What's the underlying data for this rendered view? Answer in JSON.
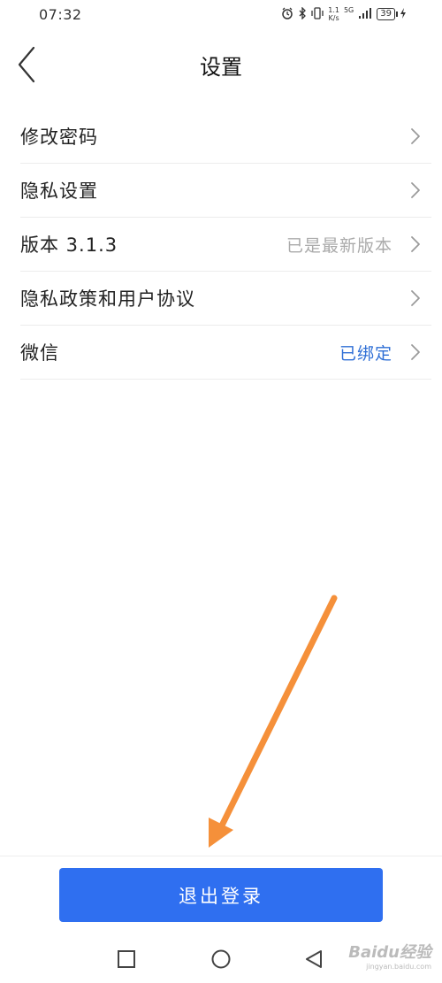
{
  "status_bar": {
    "time": "07:32",
    "speed_value": "1.1",
    "speed_unit": "K/s",
    "network": "5G",
    "battery": "39"
  },
  "header": {
    "title": "设置"
  },
  "settings": {
    "items": [
      {
        "label": "修改密码",
        "value": ""
      },
      {
        "label": "隐私设置",
        "value": ""
      },
      {
        "label": "版本 3.1.3",
        "value": "已是最新版本"
      },
      {
        "label": "隐私政策和用户协议",
        "value": ""
      },
      {
        "label": "微信",
        "value": "已绑定"
      }
    ]
  },
  "logout": {
    "label": "退出登录"
  },
  "watermark": {
    "brand": "Baidu经验",
    "url": "jingyan.baidu.com"
  },
  "colors": {
    "primary_button": "#2f6ff0",
    "value_muted": "#aaaaaa",
    "value_bound": "#2f6fd6",
    "annotation_arrow": "#f5903a"
  }
}
